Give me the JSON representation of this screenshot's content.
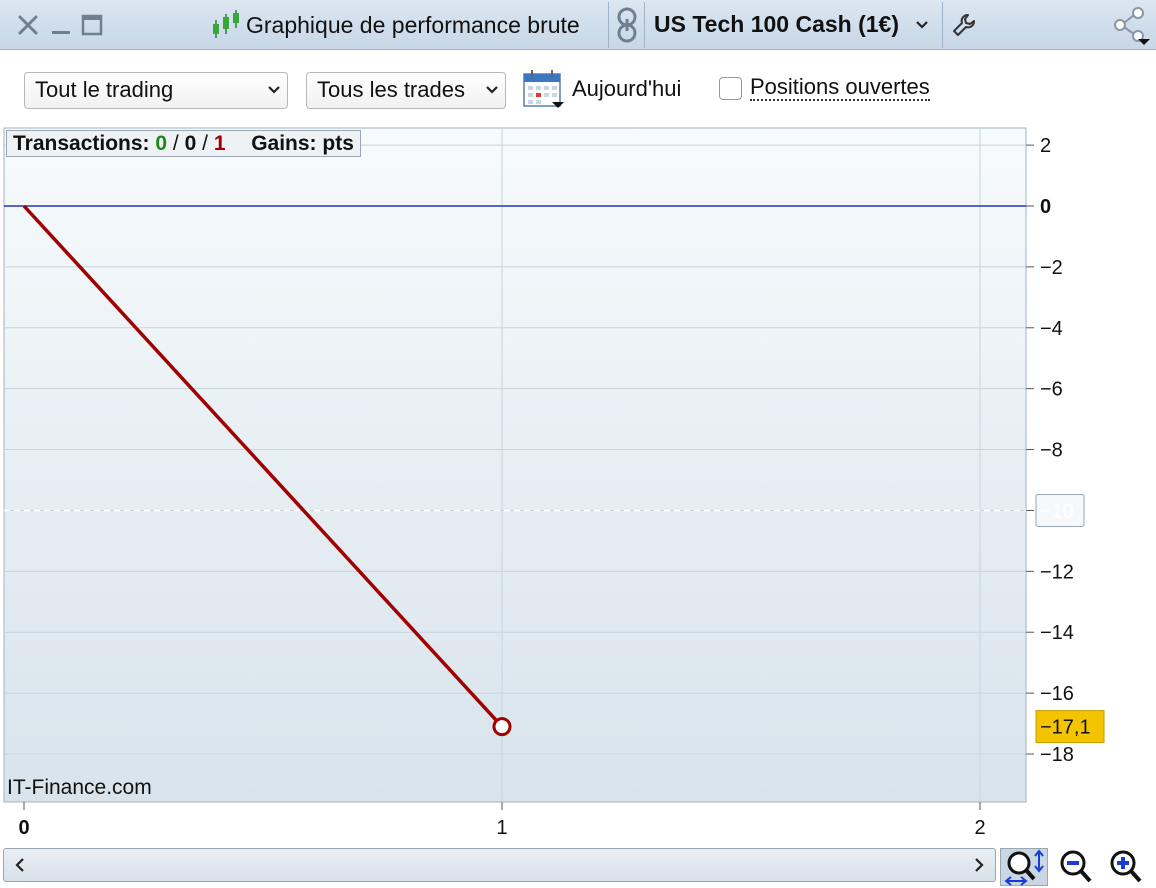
{
  "window": {
    "title": "Graphique de performance brute",
    "instrument": "US Tech 100 Cash (1€)"
  },
  "toolbar": {
    "scope_select": "Tout le trading",
    "trades_select": "Tous les trades",
    "today_label": "Aujourd'hui",
    "open_positions_label": "Positions ouvertes",
    "open_positions_checked": false
  },
  "stats": {
    "transactions_label": "Transactions:",
    "wins": "0",
    "sep1": "/",
    "neutral": "0",
    "sep2": "/",
    "losses": "1",
    "gains_label": "Gains: pts"
  },
  "watermark": "IT-Finance.com",
  "colors": {
    "line": "#a00000",
    "zero_line": "#2233bb",
    "win": "#1a8a1a",
    "loss": "#a00000",
    "last_value_badge": "#f5c400"
  },
  "chart_data": {
    "type": "line",
    "x": [
      0,
      1
    ],
    "values": [
      0,
      -17.1
    ],
    "xlim": [
      0,
      2
    ],
    "ylim": [
      -19.5,
      2.5
    ],
    "x_ticks": [
      "0",
      "1",
      "2"
    ],
    "y_ticks": [
      "2",
      "0",
      "−2",
      "−4",
      "−6",
      "−8",
      "−10",
      "−12",
      "−14",
      "−16",
      "−18"
    ],
    "y_tick_values": [
      2,
      0,
      -2,
      -4,
      -6,
      -8,
      -10,
      -12,
      -14,
      -16,
      -18
    ],
    "last_value_label": "−17,1",
    "crosshair_value": -10,
    "crosshair_label": "−10",
    "grid": true
  },
  "icons": {
    "close": "close-icon",
    "minimize": "minimize-icon",
    "maximize": "maximize-icon",
    "candles": "candlestick-icon",
    "link": "link-icon",
    "wrench": "wrench-icon",
    "share": "share-icon",
    "calendar": "calendar-icon"
  }
}
